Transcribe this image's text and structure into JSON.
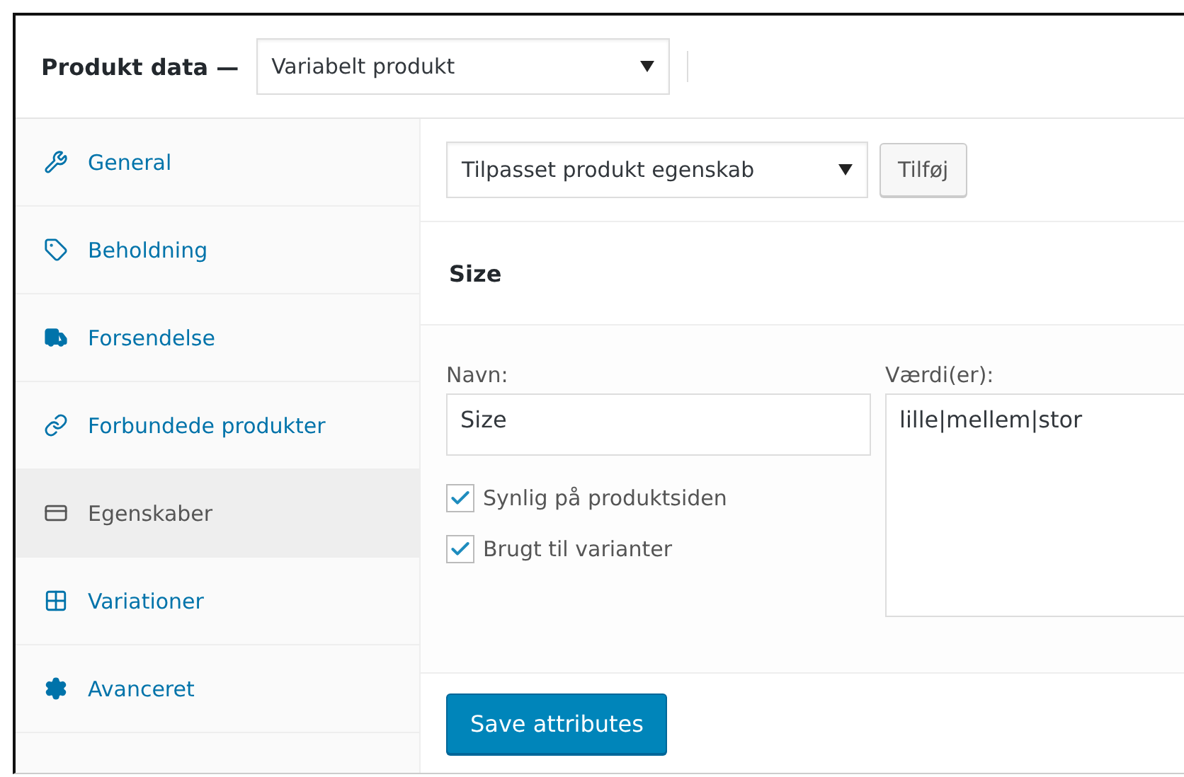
{
  "header": {
    "title": "Produkt data —",
    "product_type": "Variabelt produkt"
  },
  "sidebar": {
    "items": [
      {
        "label": "General",
        "kind": "wrench",
        "selected": false
      },
      {
        "label": "Beholdning",
        "kind": "tag",
        "selected": false
      },
      {
        "label": "Forsendelse",
        "kind": "truck",
        "selected": false
      },
      {
        "label": "Forbundede produkter",
        "kind": "link",
        "selected": false
      },
      {
        "label": "Egenskaber",
        "kind": "card",
        "selected": true
      },
      {
        "label": "Variationer",
        "kind": "grid",
        "selected": false
      },
      {
        "label": "Avanceret",
        "kind": "gear",
        "selected": false
      }
    ]
  },
  "toolbar": {
    "attribute_select": "Tilpasset produkt egenskab",
    "add_button": "Tilføj"
  },
  "attribute": {
    "title": "Size",
    "name_label": "Navn:",
    "name_value": "Size",
    "values_label": "Værdi(er):",
    "values_value": "lille|mellem|stor",
    "options": [
      {
        "label": "Synlig på produktsiden",
        "checked": true
      },
      {
        "label": "Brugt til varianter",
        "checked": true
      }
    ]
  },
  "save_button": "Save attributes"
}
